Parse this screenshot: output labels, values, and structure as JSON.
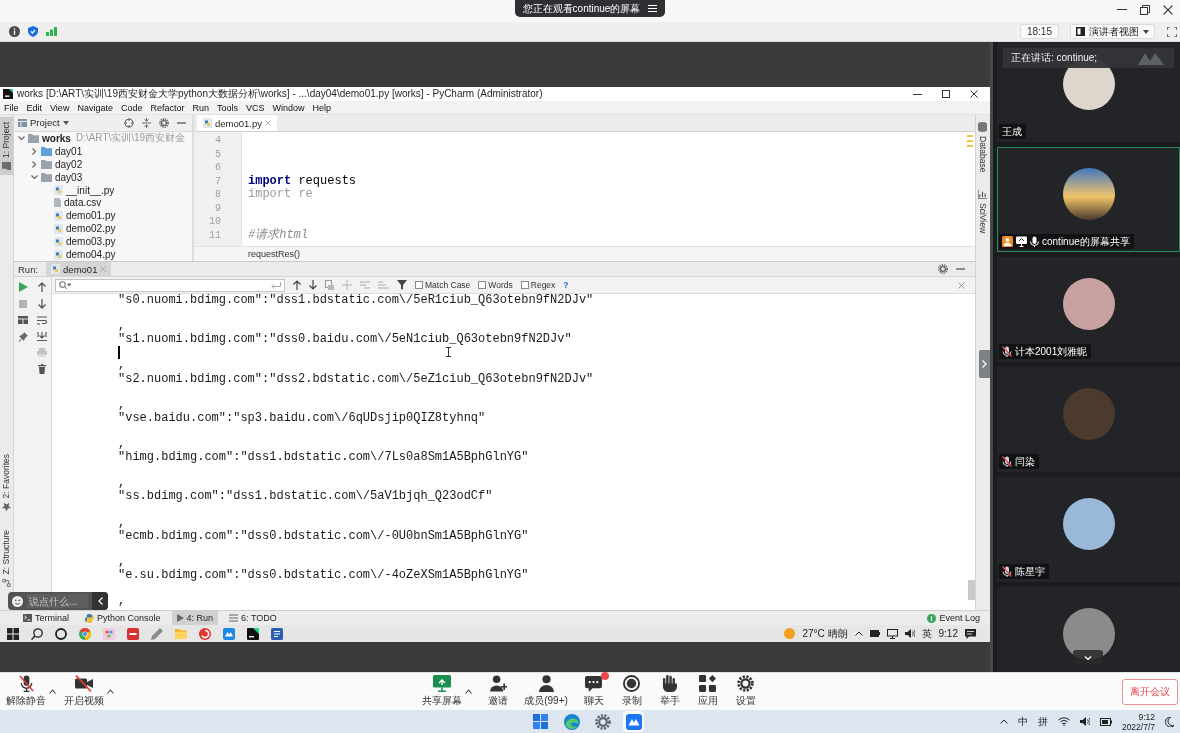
{
  "viewer_bar": {
    "banner": "您正在观看continue的屏幕",
    "time": "18:15",
    "view_mode": "演讲者视图"
  },
  "ide": {
    "title": "works [D:\\ART\\实训\\19西安财金大学python大数据分析\\works] - ...\\day04\\demo01.py [works] - PyCharm (Administrator)",
    "menu": [
      "File",
      "Edit",
      "View",
      "Navigate",
      "Code",
      "Refactor",
      "Run",
      "Tools",
      "VCS",
      "Window",
      "Help"
    ],
    "left_tools_top": [
      {
        "label": "1: Project",
        "kind": "project",
        "selected": true
      }
    ],
    "left_tools_bottom": [
      {
        "label": "2: Favorites",
        "kind": "favorites",
        "selected": false
      },
      {
        "label": "Z: Structure",
        "kind": "structure",
        "selected": false
      }
    ],
    "right_tools": [
      {
        "label": "Database",
        "kind": "database",
        "selected": false
      },
      {
        "label": "SciView",
        "kind": "sciview",
        "selected": false
      }
    ],
    "project": {
      "title": "Project",
      "tree": [
        {
          "label": "works",
          "note": "D:\\ART\\实训\\19西安财金",
          "kind": "folder",
          "expanded": true,
          "children": [
            {
              "label": "day01",
              "kind": "source_folder",
              "expanded": false
            },
            {
              "label": "day02",
              "kind": "folder",
              "expanded": false
            },
            {
              "label": "day03",
              "kind": "folder",
              "expanded": true,
              "children": [
                {
                  "label": "__init__.py",
                  "kind": "python"
                },
                {
                  "label": "data.csv",
                  "kind": "csv"
                },
                {
                  "label": "demo01.py",
                  "kind": "python"
                },
                {
                  "label": "demo02.py",
                  "kind": "python"
                },
                {
                  "label": "demo03.py",
                  "kind": "python"
                },
                {
                  "label": "demo04.py",
                  "kind": "python"
                }
              ]
            }
          ]
        }
      ]
    },
    "editor": {
      "tabs": [
        {
          "label": "demo01.py",
          "selected": true
        }
      ],
      "lines": [
        {
          "number": "4"
        },
        {
          "number": "5"
        },
        {
          "number": "6"
        },
        {
          "number": "7",
          "tokens": [
            {
              "text": "import",
              "kind": "keyword"
            },
            {
              "text": " requests",
              "kind": "plain"
            }
          ]
        },
        {
          "number": "8",
          "tokens": [
            {
              "text": "import",
              "kind": "unused"
            },
            {
              "text": " re",
              "kind": "unused"
            }
          ]
        },
        {
          "number": "9"
        },
        {
          "number": "10"
        },
        {
          "number": "11",
          "tokens": [
            {
              "text": "#请求html",
              "kind": "comment"
            }
          ]
        }
      ],
      "breadcrumb": "requestRes()"
    },
    "run": {
      "label": "Run:",
      "tabs": [
        {
          "label": "demo01",
          "selected": true
        }
      ],
      "options": [
        {
          "label": "Match Case",
          "checked": false
        },
        {
          "label": "Words",
          "checked": false
        },
        {
          "label": "Regex",
          "checked": false
        }
      ],
      "help": "?",
      "output": [
        {
          "kind": "text",
          "text": "\"s0.nuomi.bdimg.com\":\"dss1.bdstatic.com\\/5eR1ciub_Q63otebn9fN2DJv\""
        },
        {
          "kind": "blank"
        },
        {
          "kind": "text",
          "text": ","
        },
        {
          "kind": "text",
          "text": "\"s1.nuomi.bdimg.com\":\"dss0.baidu.com\\/5eN1ciub_Q63otebn9fN2DJv\""
        },
        {
          "kind": "caret"
        },
        {
          "kind": "text",
          "text": ","
        },
        {
          "kind": "text",
          "text": "\"s2.nuomi.bdimg.com\":\"dss2.bdstatic.com\\/5eZ1ciub_Q63otebn9fN2DJv\""
        },
        {
          "kind": "blank"
        },
        {
          "kind": "text",
          "text": ","
        },
        {
          "kind": "text",
          "text": "\"vse.baidu.com\":\"sp3.baidu.com\\/6qUDsjip0QIZ8tyhnq\""
        },
        {
          "kind": "blank"
        },
        {
          "kind": "text",
          "text": ","
        },
        {
          "kind": "text",
          "text": "\"himg.bdimg.com\":\"dss1.bdstatic.com\\/7Ls0a8Sm1A5BphGlnYG\""
        },
        {
          "kind": "blank"
        },
        {
          "kind": "text",
          "text": ","
        },
        {
          "kind": "text",
          "text": "\"ss.bdimg.com\":\"dss1.bdstatic.com\\/5aV1bjqh_Q23odCf\""
        },
        {
          "kind": "blank"
        },
        {
          "kind": "text",
          "text": ","
        },
        {
          "kind": "text",
          "text": "\"ecmb.bdimg.com\":\"dss0.bdstatic.com\\/-0U0bnSm1A5BphGlnYG\""
        },
        {
          "kind": "blank"
        },
        {
          "kind": "text",
          "text": ","
        },
        {
          "kind": "text",
          "text": "\"e.su.bdimg.com\":\"dss0.bdstatic.com\\/-4oZeXSm1A5BphGlnYG\""
        },
        {
          "kind": "blank"
        },
        {
          "kind": "text",
          "text": ","
        }
      ]
    },
    "bottom_tabs": [
      {
        "label": "Terminal",
        "kind": "terminal",
        "selected": false
      },
      {
        "label": "Python Console",
        "kind": "console",
        "selected": false
      },
      {
        "label": "4: Run",
        "kind": "run",
        "selected": true
      },
      {
        "label": "6: TODO",
        "kind": "todo",
        "selected": false
      }
    ],
    "event_log": "Event Log"
  },
  "chat": {
    "placeholder": "说点什么..."
  },
  "taskbar": {
    "weather": "27°C 晴朗",
    "ime": "英",
    "time": "9:12"
  },
  "participants": {
    "speaking": "正在讲话: continue;",
    "tiles": [
      {
        "name": "王成",
        "kind": "plain",
        "host": false,
        "sharing": false,
        "selected": false
      },
      {
        "name": "continue的屏幕共享",
        "kind": "open",
        "host": true,
        "sharing": true,
        "selected": true
      },
      {
        "name": "计本2001刘雅昵",
        "kind": "muted",
        "host": false,
        "sharing": false,
        "selected": false
      },
      {
        "name": "闫染",
        "kind": "muted",
        "host": false,
        "sharing": false,
        "selected": false
      },
      {
        "name": "陈星宇",
        "kind": "muted",
        "host": false,
        "sharing": false,
        "selected": false
      },
      {
        "kind": "plain",
        "host": false,
        "sharing": false,
        "selected": false
      }
    ]
  },
  "meeting_toolbar": {
    "left": [
      {
        "label": "解除静音",
        "kind": "mic_off",
        "menu": true,
        "unread": false
      },
      {
        "label": "开启视频",
        "kind": "video_off",
        "menu": true,
        "unread": false
      }
    ],
    "center": [
      {
        "label": "共享屏幕",
        "kind": "share",
        "menu": true,
        "unread": false
      },
      {
        "label": "邀请",
        "kind": "invite",
        "menu": false,
        "unread": false
      },
      {
        "label": "成员(99+)",
        "kind": "members",
        "menu": false,
        "unread": false
      },
      {
        "label": "聊天",
        "kind": "chat",
        "menu": false,
        "unread": true
      },
      {
        "label": "录制",
        "kind": "record",
        "menu": false,
        "unread": false
      },
      {
        "label": "举手",
        "kind": "hand",
        "menu": false,
        "unread": false
      },
      {
        "label": "应用",
        "kind": "apps",
        "menu": false,
        "unread": false
      },
      {
        "label": "设置",
        "kind": "settings",
        "menu": false,
        "unread": false
      }
    ],
    "leave": "离开会议"
  },
  "os_taskbar": {
    "apps": [
      {
        "kind": "start",
        "selected": false
      },
      {
        "kind": "browser",
        "selected": false
      },
      {
        "kind": "settings",
        "selected": false
      },
      {
        "kind": "meeting",
        "selected": true
      }
    ],
    "ime": "中",
    "ime_mode": "拼",
    "time": "9:12",
    "date": "2022/7/7"
  }
}
